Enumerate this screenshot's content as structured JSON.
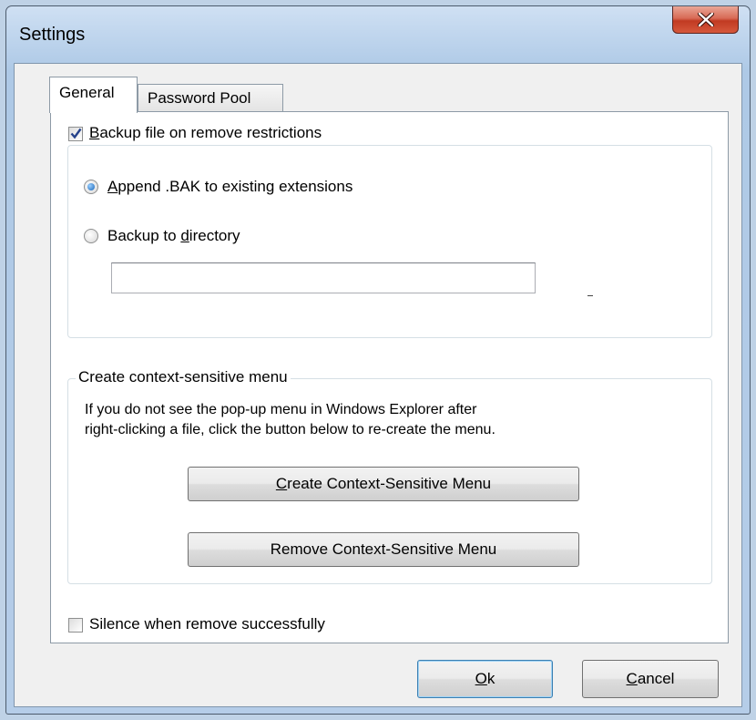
{
  "window": {
    "title": "Settings"
  },
  "tabs": [
    {
      "label": "General",
      "selected": true
    },
    {
      "label": "Password Pool",
      "selected": false
    }
  ],
  "backup": {
    "checkbox_label_key": "B",
    "checkbox_label_rest": "ackup file on remove restrictions",
    "checked": true,
    "option_append_key": "A",
    "option_append_rest": "ppend .BAK to existing extensions",
    "option_append_selected": true,
    "option_dir_pre": "Backup to ",
    "option_dir_key": "d",
    "option_dir_rest": "irectory",
    "option_dir_selected": false,
    "directory_value": ""
  },
  "context_menu": {
    "group_title": "Create context-sensitive menu",
    "description_line1": "If you do not see the pop-up menu in Windows Explorer after",
    "description_line2": "right-clicking a file, click the button below to re-create the menu.",
    "create_key": "C",
    "create_rest": "reate Context-Sensitive Menu",
    "remove_label": "Remove Context-Sensitive Menu"
  },
  "silence": {
    "label": "Silence when remove successfully",
    "checked": false
  },
  "footer": {
    "ok_key": "O",
    "ok_rest": "k",
    "cancel_key": "C",
    "cancel_rest": "ancel"
  }
}
